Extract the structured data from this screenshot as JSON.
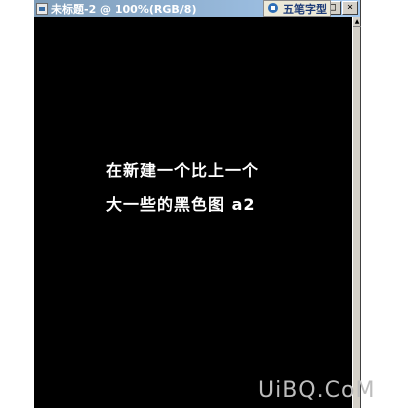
{
  "document_window": {
    "title": "未标题-2 @ 100%(RGB/8)",
    "controls": {
      "minimize": "_",
      "maximize": "□",
      "close": "×"
    }
  },
  "ime_toolbar": {
    "label": "五笔字型",
    "icon": "ime-icon"
  },
  "canvas": {
    "background_color": "#000000",
    "text_color": "#ffffff",
    "line1": "在新建一个比上一个",
    "line2": "大一些的黑色图 a2"
  },
  "watermark": {
    "text": "UiBQ.CoM"
  }
}
